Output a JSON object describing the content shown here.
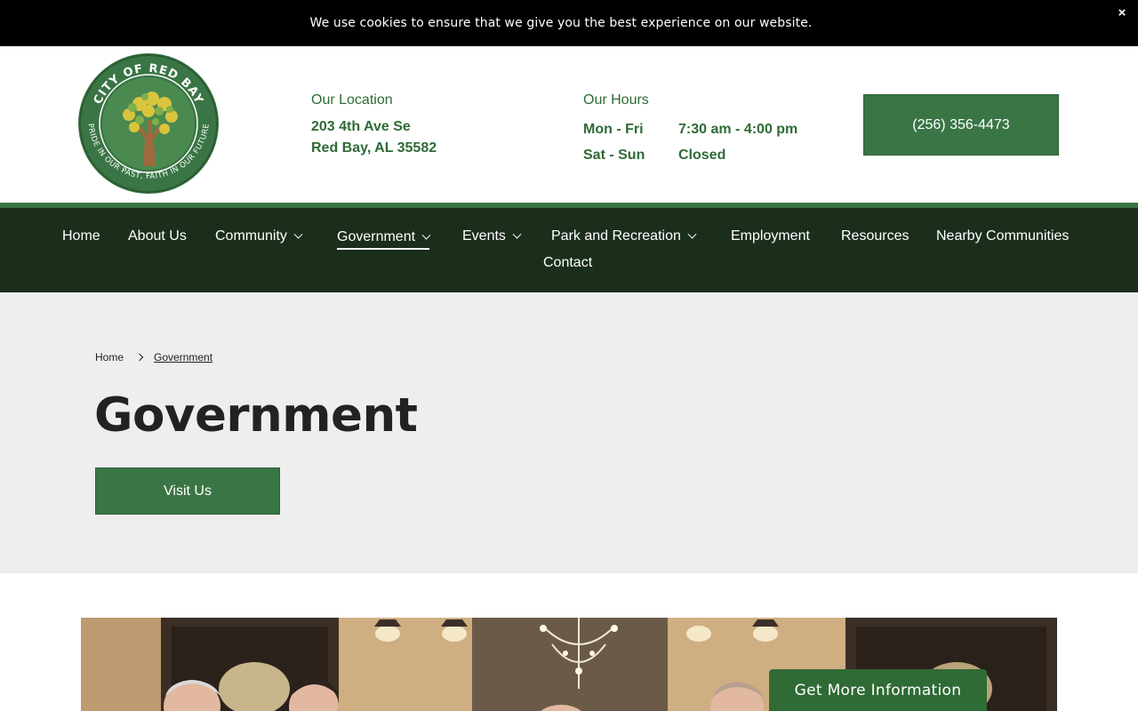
{
  "cookie": {
    "message": "We use cookies to ensure that we give you the best experience on our website.",
    "close": "×"
  },
  "logo": {
    "top_text": "CITY OF RED BAY",
    "bottom_text": "PRIDE IN OUR PAST, FAITH IN OUR FUTURE"
  },
  "location": {
    "label": "Our Location",
    "line1": "203 4th Ave Se",
    "line2": "Red Bay, AL 35582"
  },
  "hours": {
    "label": "Our Hours",
    "rows": [
      {
        "days": "Mon - Fri",
        "time": "7:30 am - 4:00 pm"
      },
      {
        "days": "Sat - Sun",
        "time": "Closed"
      }
    ]
  },
  "phone": "(256) 356-4473",
  "nav": {
    "items": [
      {
        "label": "Home"
      },
      {
        "label": "About Us"
      },
      {
        "label": "Community"
      },
      {
        "label": "Government"
      },
      {
        "label": "Events"
      },
      {
        "label": "Park and Recreation"
      },
      {
        "label": "Employment"
      },
      {
        "label": "Resources"
      },
      {
        "label": "Nearby Communities"
      },
      {
        "label": "Contact"
      }
    ]
  },
  "breadcrumb": {
    "home": "Home",
    "current": "Government"
  },
  "hero": {
    "title": "Government",
    "button": "Visit Us"
  },
  "cta": "Get More Information",
  "colors": {
    "brand_green": "#3a7545",
    "nav_dark": "#1b2e1c",
    "hero_bg": "#eeeeee"
  }
}
